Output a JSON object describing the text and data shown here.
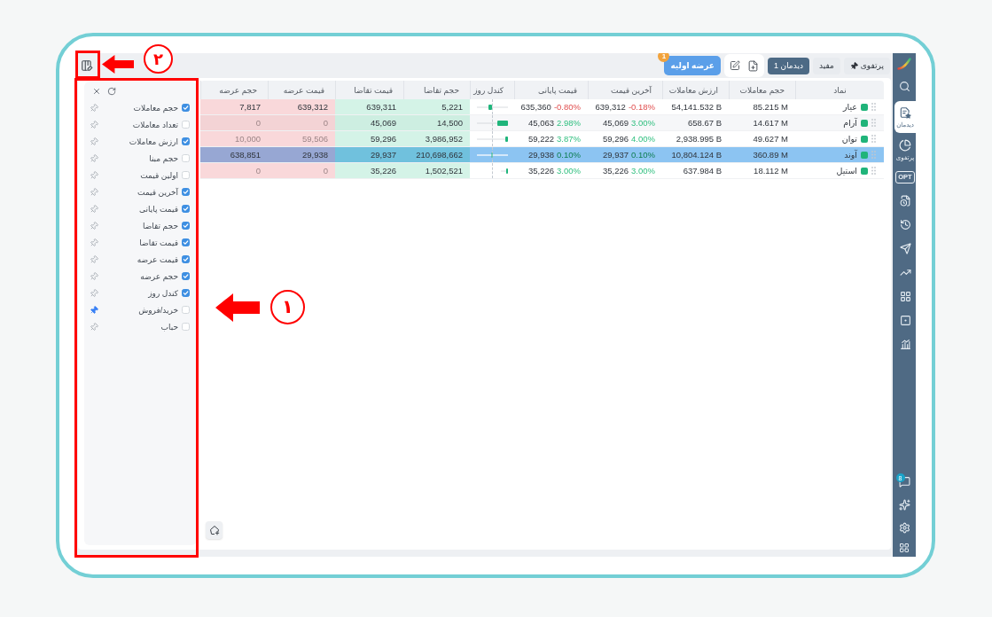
{
  "toolbar": {
    "tabs": [
      {
        "label": "پرتفوی",
        "selected": false,
        "pinned": true
      },
      {
        "label": "مفید",
        "selected": false,
        "pinned": false
      },
      {
        "label": "دیدمان 1",
        "selected": true,
        "pinned": false
      }
    ],
    "ipo_button": {
      "label": "عرضه اولیه",
      "badge": "1"
    }
  },
  "sidebar": {
    "items": [
      {
        "label": "دیدمان",
        "selected": true
      },
      {
        "label": "پرتفوی",
        "selected": false
      },
      {
        "icon_text": "OPT",
        "selected": false
      },
      {
        "selected": false
      },
      {
        "selected": false
      },
      {
        "selected": false
      },
      {
        "selected": false
      },
      {
        "selected": false
      },
      {
        "selected": false
      },
      {
        "selected": false
      }
    ],
    "chat_badge": "8"
  },
  "table": {
    "columns": [
      "نماد",
      "حجم معاملات",
      "ارزش معاملات",
      "آخرین قیمت",
      "قیمت پایانی",
      "کندل روز",
      "حجم تقاضا",
      "قیمت تقاضا",
      "قیمت عرضه",
      "حجم عرضه"
    ],
    "rows": [
      {
        "symbol": "عیار",
        "volume": "85.215 M",
        "value": "54,141.532 B",
        "last_price": {
          "price": "639,312",
          "change": "-0.18%",
          "negative": true
        },
        "close_price": {
          "price": "635,360",
          "change": "-0.80%",
          "negative": true
        },
        "bid_volume": "5,221",
        "bid_price": "639,311",
        "ask_price": "639,312",
        "ask_volume": "7,817",
        "ask_faded": false,
        "selected": false
      },
      {
        "symbol": "آرام",
        "volume": "14.617 M",
        "value": "658.67 B",
        "last_price": {
          "price": "45,069",
          "change": "3.00%",
          "negative": false
        },
        "close_price": {
          "price": "45,063",
          "change": "2.98%",
          "negative": false
        },
        "bid_volume": "14,500",
        "bid_price": "45,069",
        "ask_price": "0",
        "ask_volume": "0",
        "ask_faded": true,
        "selected": false
      },
      {
        "symbol": "توان",
        "volume": "49.627 M",
        "value": "2,938.995 B",
        "last_price": {
          "price": "59,296",
          "change": "4.00%",
          "negative": false
        },
        "close_price": {
          "price": "59,222",
          "change": "3.87%",
          "negative": false
        },
        "bid_volume": "3,986,952",
        "bid_price": "59,296",
        "ask_price": "59,506",
        "ask_volume": "10,000",
        "ask_faded": true,
        "selected": false
      },
      {
        "symbol": "آوند",
        "volume": "360.89 M",
        "value": "10,804.124 B",
        "last_price": {
          "price": "29,937",
          "change": "0.10%",
          "negative": false
        },
        "close_price": {
          "price": "29,938",
          "change": "0.10%",
          "negative": false
        },
        "bid_volume": "210,698,662",
        "bid_price": "29,937",
        "ask_price": "29,938",
        "ask_volume": "638,851",
        "ask_faded": false,
        "selected": true
      },
      {
        "symbol": "استیل",
        "volume": "18.112 M",
        "value": "637.984 B",
        "last_price": {
          "price": "35,226",
          "change": "3.00%",
          "negative": false
        },
        "close_price": {
          "price": "35,226",
          "change": "3.00%",
          "negative": false
        },
        "bid_volume": "1,502,521",
        "bid_price": "35,226",
        "ask_price": "0",
        "ask_volume": "0",
        "ask_faded": true,
        "selected": false
      }
    ]
  },
  "column_panel": {
    "items": [
      {
        "label": "حجم معاملات",
        "checked": true,
        "pinned": false
      },
      {
        "label": "تعداد معاملات",
        "checked": false,
        "pinned": false
      },
      {
        "label": "ارزش معاملات",
        "checked": true,
        "pinned": false
      },
      {
        "label": "حجم مبنا",
        "checked": false,
        "pinned": false
      },
      {
        "label": "اولین قیمت",
        "checked": false,
        "pinned": false
      },
      {
        "label": "آخرین قیمت",
        "checked": true,
        "pinned": false
      },
      {
        "label": "قیمت پایانی",
        "checked": true,
        "pinned": false
      },
      {
        "label": "حجم تقاضا",
        "checked": true,
        "pinned": false
      },
      {
        "label": "قیمت تقاضا",
        "checked": true,
        "pinned": false
      },
      {
        "label": "قیمت عرضه",
        "checked": true,
        "pinned": false
      },
      {
        "label": "حجم عرضه",
        "checked": true,
        "pinned": false
      },
      {
        "label": "کندل روز",
        "checked": true,
        "pinned": false
      },
      {
        "label": "خرید/فروش",
        "checked": false,
        "pinned": true
      },
      {
        "label": "حباب",
        "checked": false,
        "pinned": false
      }
    ]
  },
  "annotations": [
    {
      "number": "۱"
    },
    {
      "number": "۲"
    }
  ]
}
